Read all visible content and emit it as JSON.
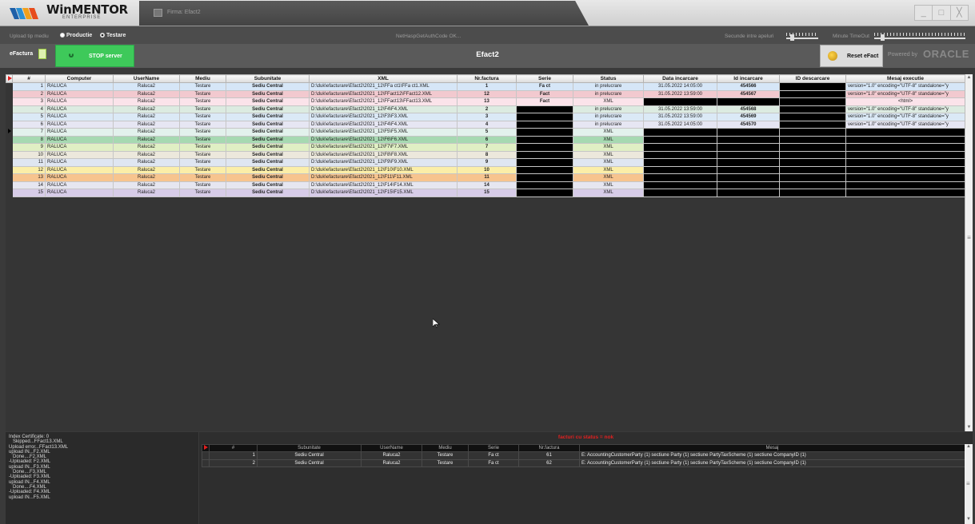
{
  "app": {
    "logo": "WinMENTOR",
    "logo_sub": "ENTERPRISE",
    "firma_label": "Firma: Efact2"
  },
  "window_buttons": [
    "_",
    "□",
    "╳"
  ],
  "options": {
    "upload_label": "Upload tip mediu",
    "radio_productie": "Productie",
    "radio_testare": "Testare",
    "selected": "Testare",
    "auth_status": "NetHaspGetAuthCode OK...",
    "secunde_label": "Secunde intre apeluri",
    "minute_label": "Minute TimeOut"
  },
  "toolbar": {
    "efactura_label": "eFactura",
    "stop_label": "STOP server",
    "title": "Efact2",
    "reset_label": "Reset eFact",
    "powered": "Powered by",
    "oracle": "ORACLE"
  },
  "colors": {
    "stop_button": "#3ec95a",
    "bottom_title": "#e02020"
  },
  "grid": {
    "headers": [
      "#",
      "Computer",
      "UserName",
      "Mediu",
      "Subunitate",
      "XML",
      "Nr.factura",
      "Serie",
      "Status",
      "Data incarcare",
      "Id incarcare",
      "ID descarcare",
      "Mesaj executie"
    ],
    "rows": [
      {
        "n": "1",
        "computer": "RALUCA",
        "user": "Raluca2",
        "mediu": "Testare",
        "sub": "Sediu Central",
        "xml": "D:\\duk\\efacturare\\Efact2\\2021_12\\FFa ct1\\FFa ct1.XML",
        "nr": "1",
        "serie": "Fa ct",
        "status": "in prelucrare",
        "data": "31.05.2022 14:05:00",
        "id": "454566",
        "idd": "",
        "msg": "version=\"1.0\" encoding=\"UTF-8\" standalone=\"y",
        "bg": "#d6e6f7"
      },
      {
        "n": "2",
        "computer": "RALUCA",
        "user": "Raluca2",
        "mediu": "Testare",
        "sub": "Sediu Central",
        "xml": "D:\\duk\\efacturare\\Efact2\\2021_12\\FFact12\\FFact12.XML",
        "nr": "12",
        "serie": "Fact",
        "status": "in prelucrare",
        "data": "31.05.2022 13:59:00",
        "id": "454567",
        "idd": "",
        "msg": "version=\"1.0\" encoding=\"UTF-8\" standalone=\"y",
        "bg": "#f2c9cf"
      },
      {
        "n": "3",
        "computer": "RALUCA",
        "user": "Raluca2",
        "mediu": "Testare",
        "sub": "Sediu Central",
        "xml": "D:\\duk\\efacturare\\Efact2\\2021_12\\FFact13\\FFact13.XML",
        "nr": "13",
        "serie": "Fact",
        "status": "XML",
        "data": "",
        "id": "",
        "idd": "",
        "msg": "<html>",
        "bg": "#fbe3ea"
      },
      {
        "n": "4",
        "computer": "RALUCA",
        "user": "Raluca2",
        "mediu": "Testare",
        "sub": "Sediu Central",
        "xml": "D:\\duk\\efacturare\\Efact2\\2021_12\\F4\\F4.XML",
        "nr": "2",
        "serie": "",
        "status": "in prelucrare",
        "data": "31.05.2022 13:59:00",
        "id": "454568",
        "idd": "",
        "msg": "version=\"1.0\" encoding=\"UTF-8\" standalone=\"y",
        "bg": "#dcebe1"
      },
      {
        "n": "5",
        "computer": "RALUCA",
        "user": "Raluca2",
        "mediu": "Testare",
        "sub": "Sediu Central",
        "xml": "D:\\duk\\efacturare\\Efact2\\2021_12\\F3\\F3.XML",
        "nr": "3",
        "serie": "",
        "status": "in prelucrare",
        "data": "31.05.2022 13:59:00",
        "id": "454569",
        "idd": "",
        "msg": "version=\"1.0\" encoding=\"UTF-8\" standalone=\"y",
        "bg": "#dbe9f6"
      },
      {
        "n": "6",
        "computer": "RALUCA",
        "user": "Raluca2",
        "mediu": "Testare",
        "sub": "Sediu Central",
        "xml": "D:\\duk\\efacturare\\Efact2\\2021_12\\F4\\F4.XML",
        "nr": "4",
        "serie": "",
        "status": "in prelucrare",
        "data": "31.05.2022 14:05:00",
        "id": "454570",
        "idd": "",
        "msg": "version=\"1.0\" encoding=\"UTF-8\" standalone=\"y",
        "bg": "#e6e6f3"
      },
      {
        "n": "7",
        "computer": "RALUCA",
        "user": "Raluca2",
        "mediu": "Testare",
        "sub": "Sediu Central",
        "xml": "D:\\duk\\efacturare\\Efact2\\2021_12\\F5\\F5.XML",
        "nr": "5",
        "serie": "",
        "status": "XML",
        "data": "",
        "id": "",
        "idd": "",
        "msg": "",
        "bg": "#e2f1ec"
      },
      {
        "n": "8",
        "computer": "RALUCA",
        "user": "Raluca2",
        "mediu": "Testare",
        "sub": "Sediu Central",
        "xml": "D:\\duk\\efacturare\\Efact2\\2021_12\\F6\\F6.XML",
        "nr": "6",
        "serie": "",
        "status": "XML",
        "data": "",
        "id": "",
        "idd": "",
        "msg": "",
        "bg": "#a6d9b1"
      },
      {
        "n": "9",
        "computer": "RALUCA",
        "user": "Raluca2",
        "mediu": "Testare",
        "sub": "Sediu Central",
        "xml": "D:\\duk\\efacturare\\Efact2\\2021_12\\F7\\F7.XML",
        "nr": "7",
        "serie": "",
        "status": "XML",
        "data": "",
        "id": "",
        "idd": "",
        "msg": "",
        "bg": "#e0efc4"
      },
      {
        "n": "10",
        "computer": "RALUCA",
        "user": "Raluca2",
        "mediu": "Testare",
        "sub": "Sediu Central",
        "xml": "D:\\duk\\efacturare\\Efact2\\2021_12\\F8\\F8.XML",
        "nr": "8",
        "serie": "",
        "status": "XML",
        "data": "",
        "id": "",
        "idd": "",
        "msg": "",
        "bg": "#ece8dc"
      },
      {
        "n": "11",
        "computer": "RALUCA",
        "user": "Raluca2",
        "mediu": "Testare",
        "sub": "Sediu Central",
        "xml": "D:\\duk\\efacturare\\Efact2\\2021_12\\F9\\F9.XML",
        "nr": "9",
        "serie": "",
        "status": "XML",
        "data": "",
        "id": "",
        "idd": "",
        "msg": "",
        "bg": "#dfe6f1"
      },
      {
        "n": "12",
        "computer": "RALUCA",
        "user": "Raluca2",
        "mediu": "Testare",
        "sub": "Sediu Central",
        "xml": "D:\\duk\\efacturare\\Efact2\\2021_12\\F10\\F10.XML",
        "nr": "10",
        "serie": "",
        "status": "XML",
        "data": "",
        "id": "",
        "idd": "",
        "msg": "",
        "bg": "#fbeea8"
      },
      {
        "n": "13",
        "computer": "RALUCA",
        "user": "Raluca2",
        "mediu": "Testare",
        "sub": "Sediu Central",
        "xml": "D:\\duk\\efacturare\\Efact2\\2021_12\\F11\\F11.XML",
        "nr": "11",
        "serie": "",
        "status": "XML",
        "data": "",
        "id": "",
        "idd": "",
        "msg": "",
        "bg": "#f7c48e"
      },
      {
        "n": "14",
        "computer": "RALUCA",
        "user": "Raluca2",
        "mediu": "Testare",
        "sub": "Sediu Central",
        "xml": "D:\\duk\\efacturare\\Efact2\\2021_12\\F14\\F14.XML",
        "nr": "14",
        "serie": "",
        "status": "XML",
        "data": "",
        "id": "",
        "idd": "",
        "msg": "",
        "bg": "#e6e6f0"
      },
      {
        "n": "15",
        "computer": "RALUCA",
        "user": "Raluca2",
        "mediu": "Testare",
        "sub": "Sediu Central",
        "xml": "D:\\duk\\efacturare\\Efact2\\2021_12\\F15\\F15.XML",
        "nr": "15",
        "serie": "",
        "status": "XML",
        "data": "",
        "id": "",
        "idd": "",
        "msg": "",
        "bg": "#d7cce8"
      }
    ]
  },
  "log": "Index Certificate: 0\n   Skipped...FFact13.XML\nUpload error...FFact13.XML\nupload IN...F2.XML\n   Done....F2.XML\n-Uploaded: F2.XML\nupload IN...F3.XML\n   Done....F3.XML\n-Uploaded: F3.XML\nupload IN...F4.XML\n   Done....F4.XML\n-Uploaded: F4.XML\nupload IN...F5.XML",
  "bottom": {
    "title": "facturi cu status = nok",
    "headers": [
      "#",
      "Subunitate",
      "UserName",
      "Mediu",
      "Serie",
      "Nr.factura",
      "Mesaj"
    ],
    "rows": [
      {
        "n": "1",
        "sub": "Sediu Central",
        "user": "Raluca2",
        "mediu": "Testare",
        "serie": "Fa ct",
        "nr": "61",
        "msg": "E: AccountingCustomerParty (1) sectiune Party (1) sectiune PartyTaxScheme (1) sectiune CompanyID (1)"
      },
      {
        "n": "2",
        "sub": "Sediu Central",
        "user": "Raluca2",
        "mediu": "Testare",
        "serie": "Fa ct",
        "nr": "62",
        "msg": "E: AccountingCustomerParty (1) sectiune Party (1) sectiune PartyTaxScheme (1) sectiune CompanyID (1)"
      }
    ]
  }
}
